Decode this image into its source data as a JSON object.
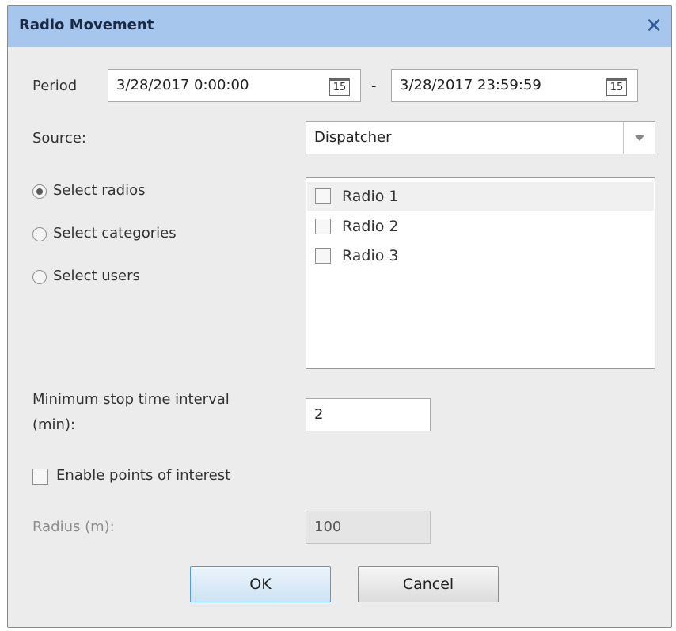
{
  "window": {
    "title": "Radio Movement",
    "close_glyph": "✕",
    "close_icon": "close-icon"
  },
  "period": {
    "label": "Period",
    "start": "3/28/2017 0:00:00",
    "end": "3/28/2017 23:59:59",
    "separator": "-",
    "calendar_day": "15",
    "calendar_icon": "calendar-icon"
  },
  "source": {
    "label": "Source:",
    "value": "Dispatcher",
    "arrow_icon": "dropdown-arrow-icon"
  },
  "selection_mode": {
    "options": [
      "Select radios",
      "Select categories",
      "Select users"
    ],
    "selected_index": 0
  },
  "radios_list": {
    "items": [
      {
        "label": "Radio 1",
        "checked": false,
        "highlighted": true
      },
      {
        "label": "Radio 2",
        "checked": false,
        "highlighted": false
      },
      {
        "label": "Radio 3",
        "checked": false,
        "highlighted": false
      }
    ]
  },
  "min_stop": {
    "label_line1": "Minimum stop time interval",
    "label_line2": "(min):",
    "value": "2"
  },
  "points_of_interest": {
    "label": "Enable points of interest",
    "checked": false
  },
  "radius": {
    "label": "Radius (m):",
    "value": "100",
    "enabled": false
  },
  "buttons": {
    "ok": "OK",
    "cancel": "Cancel"
  },
  "colors": {
    "titlebar": "#a6c6ee",
    "dialog_bg": "#ececec",
    "ok_border": "#4e9ede"
  }
}
